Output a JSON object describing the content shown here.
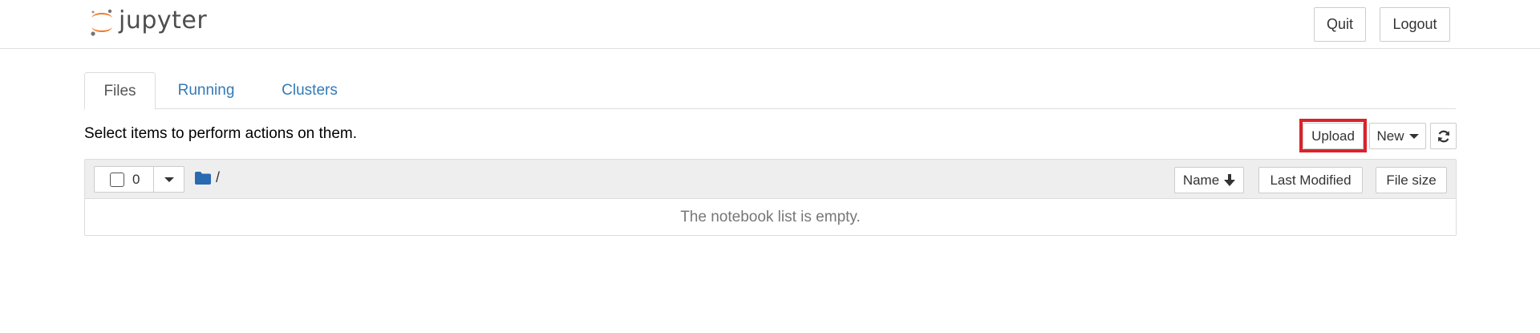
{
  "header": {
    "logo_text": "jupyter",
    "quit_label": "Quit",
    "logout_label": "Logout"
  },
  "tabs": [
    {
      "label": "Files",
      "active": true
    },
    {
      "label": "Running",
      "active": false
    },
    {
      "label": "Clusters",
      "active": false
    }
  ],
  "toolbar": {
    "hint": "Select items to perform actions on them.",
    "upload_label": "Upload",
    "new_label": "New",
    "refresh_icon": "refresh-icon"
  },
  "list": {
    "selected_count": "0",
    "breadcrumb": "/",
    "sort_name_label": "Name",
    "sort_modified_label": "Last Modified",
    "sort_size_label": "File size",
    "empty_message": "The notebook list is empty."
  },
  "colors": {
    "link": "#337ab7",
    "highlight": "#d9232b",
    "folder": "#2a6ab0",
    "logo_orange": "#f37726"
  }
}
